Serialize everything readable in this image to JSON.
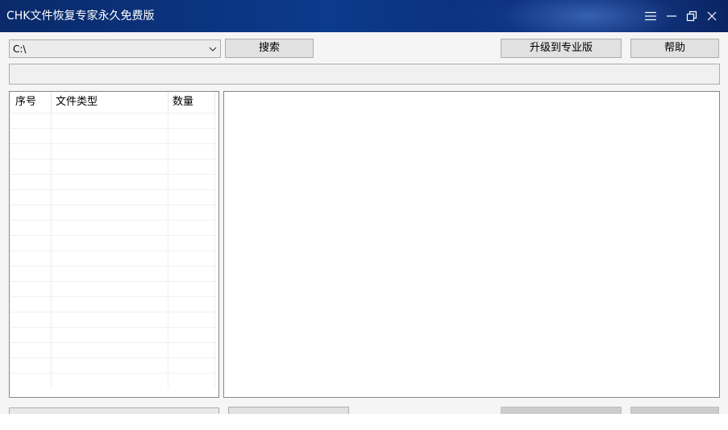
{
  "window": {
    "title": "CHK文件恢复专家永久免费版",
    "controls": [
      "menu-icon",
      "minimize-icon",
      "restore-icon",
      "close-icon"
    ],
    "accent_color": "#0c3a8c"
  },
  "toolbar": {
    "drive_select": {
      "value": "C:\\"
    },
    "search_label": "搜索",
    "upgrade_label": "升级到专业版",
    "help_label": "帮助"
  },
  "path_bar": {
    "value": ""
  },
  "file_types": {
    "columns": [
      "序号",
      "文件类型",
      "数量"
    ],
    "rows": []
  },
  "bottom": {
    "smart_detect_label": "",
    "batch_recover_label": "",
    "single_recover_label": ""
  }
}
